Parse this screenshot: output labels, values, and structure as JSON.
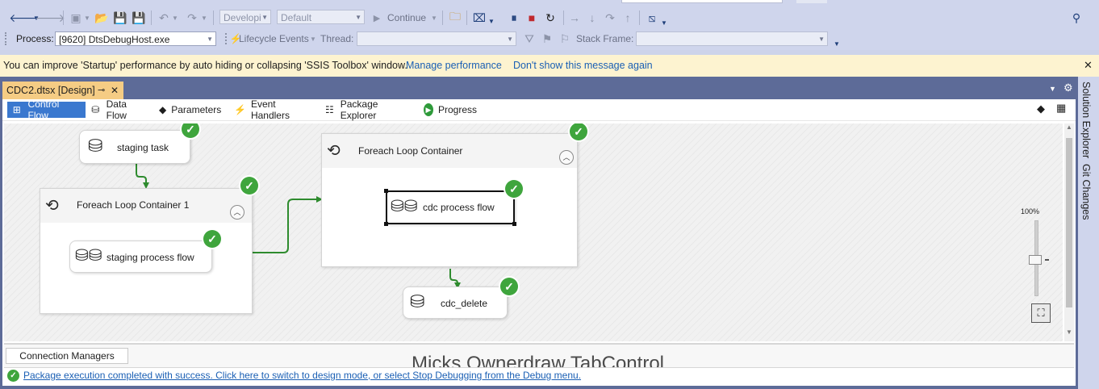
{
  "toolbar1": {
    "config_combo": "Developi",
    "platform_combo": "Default",
    "continue_label": "Continue"
  },
  "toolbar2": {
    "process_label": "Process:",
    "process_value": "[9620] DtsDebugHost.exe",
    "lifecycle_label": "Lifecycle Events",
    "thread_label": "Thread:",
    "stack_frame_label": "Stack Frame:"
  },
  "infobar": {
    "message": "You can improve 'Startup' performance by auto hiding or collapsing 'SSIS Toolbox' window.",
    "manage_link": "Manage performance",
    "dont_show_link": "Don't show this message again",
    "close_glyph": "✕"
  },
  "document_tab": {
    "title": "CDC2.dtsx [Design]",
    "pin_glyph": "⊸",
    "close_glyph": "✕"
  },
  "designer_tabs": [
    {
      "label": "Control Flow",
      "icon": "control-flow-icon",
      "active": true
    },
    {
      "label": "Data Flow",
      "icon": "data-flow-icon",
      "active": false
    },
    {
      "label": "Parameters",
      "icon": "parameters-icon",
      "active": false
    },
    {
      "label": "Event Handlers",
      "icon": "event-handlers-icon",
      "active": false
    },
    {
      "label": "Package Explorer",
      "icon": "package-explorer-icon",
      "active": false
    },
    {
      "label": "Progress",
      "icon": "progress-icon",
      "active": false
    }
  ],
  "canvas": {
    "staging_task": "staging task",
    "foreach1_title": "Foreach Loop Container 1",
    "staging_flow": "staging process flow",
    "foreach2_title": "Foreach Loop Container",
    "cdc_flow": "cdc process flow",
    "cdc_delete": "cdc_delete",
    "status_color": "#3fa53d",
    "precedence_color": "#2e8b2e"
  },
  "zoom": {
    "label": "100%",
    "level_percent": 100
  },
  "bottom": {
    "connection_managers_tab": "Connection Managers",
    "ghost_text": "Micks Ownerdraw TabControl",
    "status_message": "Package execution completed with success. Click here to switch to design mode, or select Stop Debugging from the Debug menu."
  },
  "right_panel": {
    "solution_explorer": "Solution Explorer",
    "git_changes": "Git Changes"
  },
  "colors": {
    "accent": "#3a78cf",
    "infobar_bg": "#fdf3d0",
    "doc_tab_bg": "#f5cc84"
  }
}
